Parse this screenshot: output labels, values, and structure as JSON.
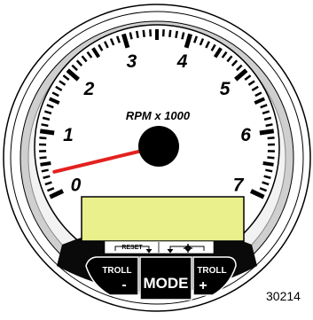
{
  "gauge": {
    "scale_label": "RPM x 1000",
    "dial_numbers": [
      "0",
      "1",
      "2",
      "3",
      "4",
      "5",
      "6",
      "7"
    ],
    "min": 0,
    "max": 7,
    "needle_value": 0.35,
    "colors": {
      "needle": "#e3211f",
      "lcd": "#eaf08c",
      "face": "#ffffff",
      "bezel": "#cfcfcf"
    }
  },
  "controls": {
    "reset_label": "RESET",
    "settings_icon": "gear-icon",
    "troll_minus": {
      "label": "TROLL",
      "symbol": "-"
    },
    "mode_label": "MODE",
    "troll_plus": {
      "label": "TROLL",
      "symbol": "+"
    }
  },
  "figure_id": "30214"
}
